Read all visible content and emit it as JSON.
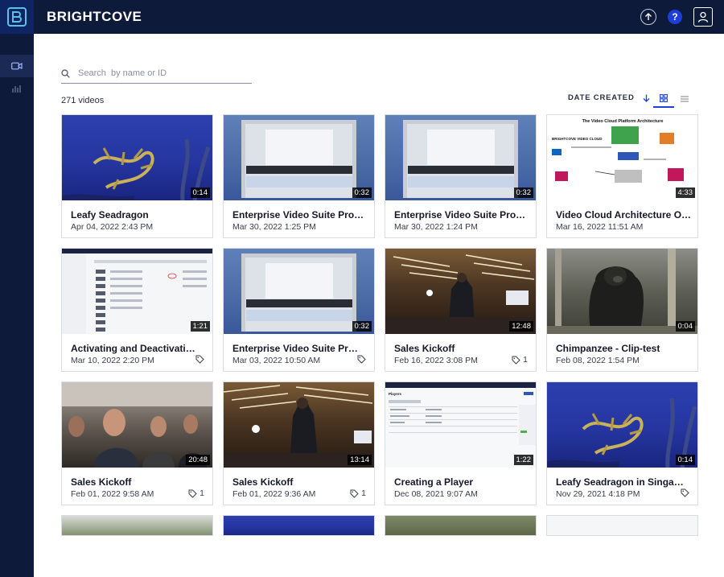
{
  "app": {
    "brand": "BRIGHTCOVE"
  },
  "header": {
    "help_label": "?"
  },
  "search": {
    "placeholder": "Search  by name or ID"
  },
  "video_count": "271 videos",
  "sort": {
    "label": "DATE CREATED"
  },
  "videos": [
    {
      "title": "Leafy Seadragon",
      "date": "Apr 04, 2022 2:43 PM",
      "duration": "0:14",
      "tag_count": ""
    },
    {
      "title": "Enterprise Video Suite Prom...",
      "date": "Mar 30, 2022 1:25 PM",
      "duration": "0:32",
      "tag_count": ""
    },
    {
      "title": "Enterprise Video Suite Prom...",
      "date": "Mar 30, 2022 1:24 PM",
      "duration": "0:32",
      "tag_count": ""
    },
    {
      "title": "Video Cloud Architecture Ov...",
      "date": "Mar 16, 2022 11:51 AM",
      "duration": "4:33",
      "tag_count": ""
    },
    {
      "title": "Activating and Deactivating ...",
      "date": "Mar 10, 2022 2:20 PM",
      "duration": "1:21",
      "tag_count": ""
    },
    {
      "title": "Enterprise Video Suite Prom...",
      "date": "Mar 03, 2022 10:50 AM",
      "duration": "0:32",
      "tag_count": ""
    },
    {
      "title": "Sales Kickoff",
      "date": "Feb 16, 2022 3:08 PM",
      "duration": "12:48",
      "tag_count": "1"
    },
    {
      "title": "Chimpanzee - Clip-test",
      "date": "Feb 08, 2022 1:54 PM",
      "duration": "0:04",
      "tag_count": ""
    },
    {
      "title": "Sales Kickoff",
      "date": "Feb 01, 2022 9:58 AM",
      "duration": "20:48",
      "tag_count": "1"
    },
    {
      "title": "Sales Kickoff",
      "date": "Feb 01, 2022 9:36 AM",
      "duration": "13:14",
      "tag_count": "1"
    },
    {
      "title": "Creating a Player",
      "date": "Dec 08, 2021 9:07 AM",
      "duration": "1:22",
      "tag_count": ""
    },
    {
      "title": "Leafy Seadragon in Singapore",
      "date": "Nov 29, 2021 4:18 PM",
      "duration": "0:14",
      "tag_count": ""
    }
  ],
  "thumb_text": {
    "arch_title": "The Video Cloud Platform Architecture",
    "arch_brand": "BRIGHTCOVE VIDEO CLOUD",
    "player_title": "Players"
  },
  "colors": {
    "nav_bg": "#0e1a3a",
    "accent": "#1d3fd6"
  }
}
